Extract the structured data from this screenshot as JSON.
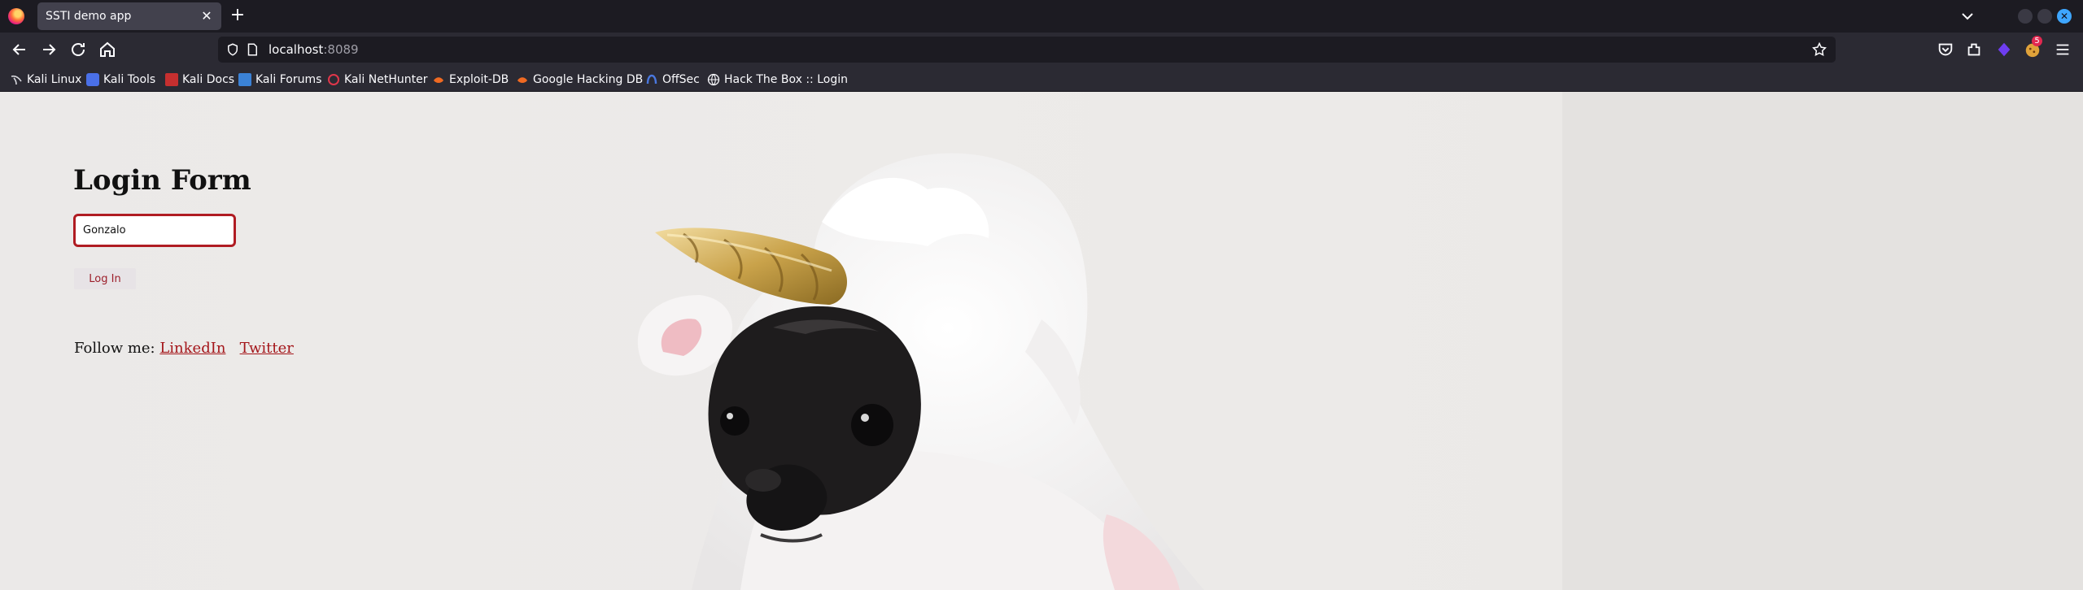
{
  "browser": {
    "tab": {
      "title": "SSTI demo app"
    },
    "url": {
      "host": "localhost",
      "port": ":8089"
    },
    "bookmarks": [
      "Kali Linux",
      "Kali Tools",
      "Kali Docs",
      "Kali Forums",
      "Kali NetHunter",
      "Exploit-DB",
      "Google Hacking DB",
      "OffSec",
      "Hack The Box :: Login"
    ],
    "extension_badge": "5",
    "colors": {
      "chrome": "#2b2a33",
      "tabbar": "#1c1b22",
      "accent": "#3ea6ff"
    }
  },
  "page": {
    "title": "Login Form",
    "username_value": "Gonzalo",
    "login_label": "Log In",
    "follow_label": "Follow me:",
    "links": [
      "LinkedIn",
      "Twitter"
    ],
    "colors": {
      "link": "#a4161a",
      "input_border": "#b01c22"
    }
  }
}
